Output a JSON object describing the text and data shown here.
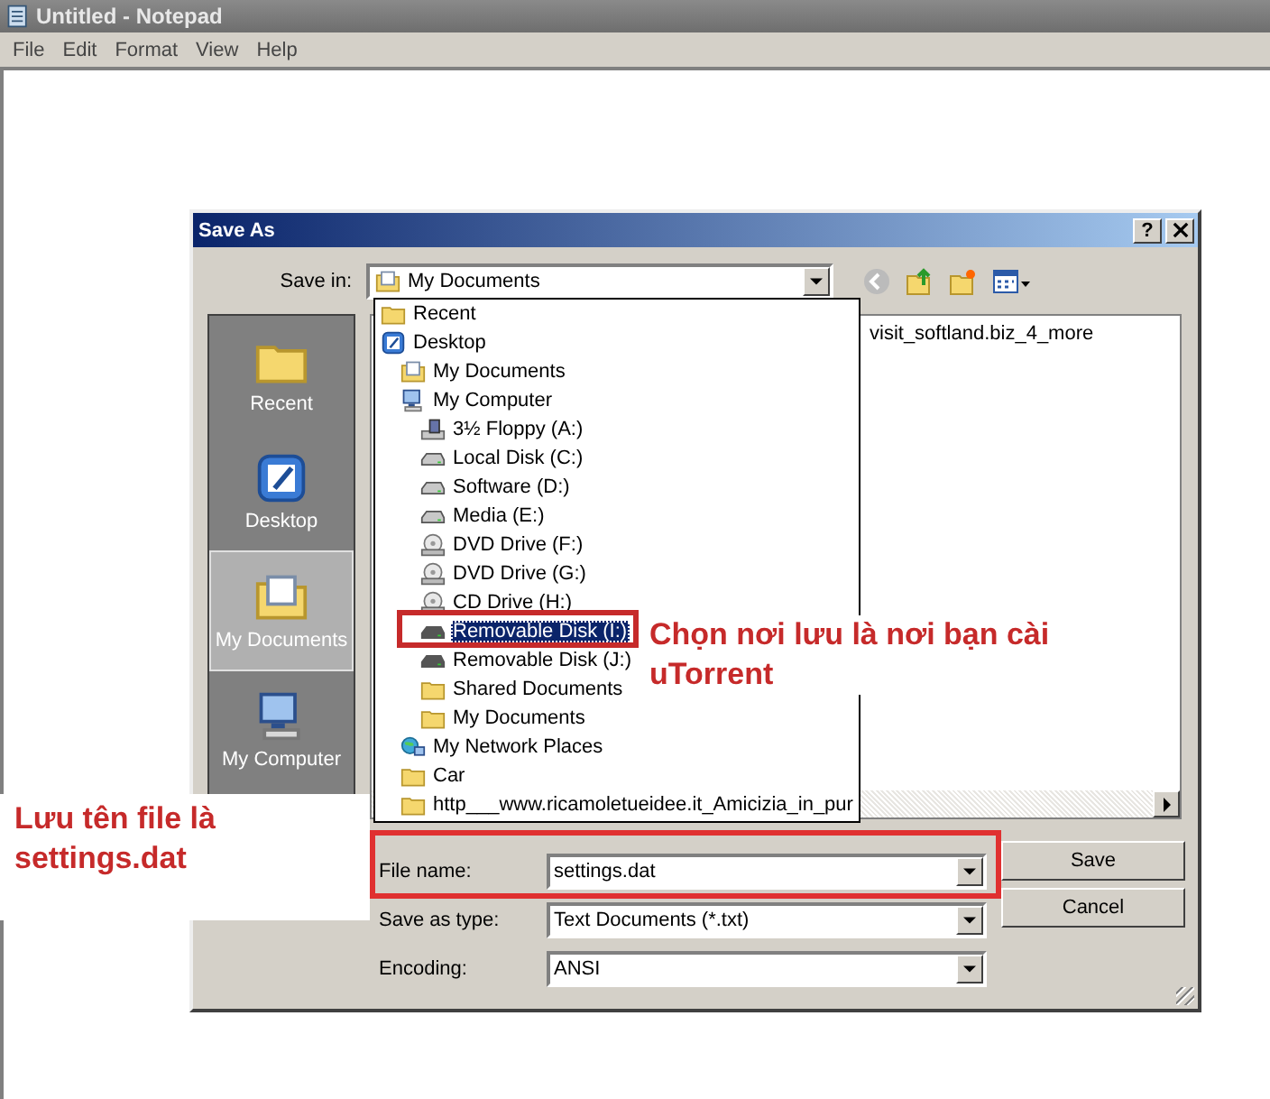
{
  "notepad": {
    "title": "Untitled - Notepad",
    "menu": [
      "File",
      "Edit",
      "Format",
      "View",
      "Help"
    ]
  },
  "dialog": {
    "title": "Save As",
    "help_button": "?",
    "save_in": {
      "label": "Save in:",
      "value": "My Documents"
    },
    "places": [
      {
        "label": "Recent",
        "kind": "recent",
        "selected": false
      },
      {
        "label": "Desktop",
        "kind": "desktop",
        "selected": false
      },
      {
        "label": "My Documents",
        "kind": "documents",
        "selected": true
      },
      {
        "label": "My Computer",
        "kind": "computer",
        "selected": false
      }
    ],
    "file_list": [
      "visit_softland.biz_4_more"
    ],
    "save_in_dropdown": [
      {
        "label": "Recent",
        "kind": "folder",
        "selected": false
      },
      {
        "label": "Desktop",
        "kind": "desktop",
        "selected": false,
        "children": [
          {
            "label": "My Documents",
            "kind": "documents",
            "selected": false
          },
          {
            "label": "My Computer",
            "kind": "computer",
            "selected": false,
            "children": [
              {
                "label": "3½ Floppy (A:)",
                "kind": "floppy",
                "selected": false
              },
              {
                "label": "Local Disk (C:)",
                "kind": "disk",
                "selected": false
              },
              {
                "label": "Software (D:)",
                "kind": "disk",
                "selected": false
              },
              {
                "label": "Media (E:)",
                "kind": "disk",
                "selected": false
              },
              {
                "label": "DVD Drive (F:)",
                "kind": "dvd",
                "selected": false
              },
              {
                "label": "DVD Drive (G:)",
                "kind": "dvd",
                "selected": false
              },
              {
                "label": "CD Drive (H:)",
                "kind": "cd",
                "selected": false
              },
              {
                "label": "Removable Disk (I:)",
                "kind": "removable",
                "selected": true
              },
              {
                "label": "Removable Disk (J:)",
                "kind": "removable",
                "selected": false
              },
              {
                "label": "Shared Documents",
                "kind": "folder",
                "selected": false
              },
              {
                "label": "My Documents",
                "kind": "folder",
                "selected": false
              }
            ]
          },
          {
            "label": "My Network Places",
            "kind": "network",
            "selected": false
          },
          {
            "label": "Car",
            "kind": "folder",
            "selected": false
          },
          {
            "label": "http___www.ricamoletueidee.it_Amicizia_in_pur",
            "kind": "folder",
            "selected": false
          }
        ]
      }
    ],
    "fields": [
      {
        "label": "File name:",
        "value": "settings.dat"
      },
      {
        "label": "Save as type:",
        "value": "Text Documents (*.txt)"
      },
      {
        "label": "Encoding:",
        "value": "ANSI"
      }
    ],
    "buttons": [
      "Save",
      "Cancel"
    ]
  },
  "annotations": [
    {
      "text": "Chọn nơi lưu là nơi bạn cài uTorrent"
    },
    {
      "text": "Lưu tên file là settings.dat"
    }
  ]
}
